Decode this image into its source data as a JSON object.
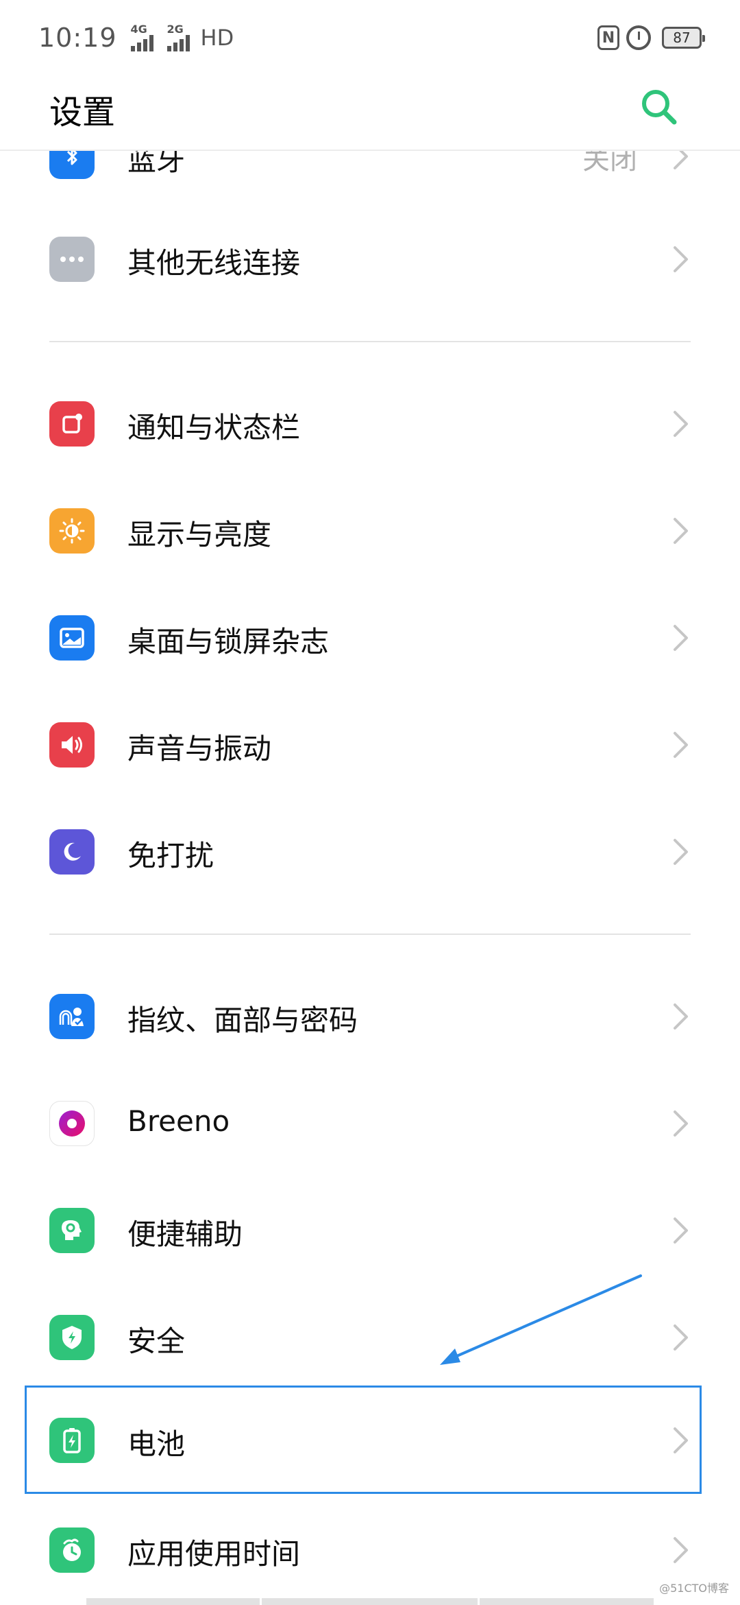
{
  "status_bar": {
    "time": "10:19",
    "signal1": "4G",
    "signal2": "2G",
    "hd": "HD",
    "nfc": "N",
    "battery": "87"
  },
  "header": {
    "title": "设置"
  },
  "rows": [
    {
      "label": "蓝牙",
      "value": "关闭",
      "icon": "bluetooth-icon",
      "color": "#1a7cf0"
    },
    {
      "label": "其他无线连接",
      "icon": "more-icon",
      "color": "#b7bcc4"
    },
    {
      "label": "通知与状态栏",
      "icon": "notification-icon",
      "color": "#e8404b"
    },
    {
      "label": "显示与亮度",
      "icon": "brightness-icon",
      "color": "#f7a531"
    },
    {
      "label": "桌面与锁屏杂志",
      "icon": "wallpaper-icon",
      "color": "#1a7cf0"
    },
    {
      "label": "声音与振动",
      "icon": "speaker-icon",
      "color": "#e8404b"
    },
    {
      "label": "免打扰",
      "icon": "moon-icon",
      "color": "#5d56d8"
    },
    {
      "label": "指纹、面部与密码",
      "icon": "fingerprint-icon",
      "color": "#1a7cf0"
    },
    {
      "label": "Breeno",
      "icon": "breeno-icon",
      "color": "#ffffff"
    },
    {
      "label": "便捷辅助",
      "icon": "assist-icon",
      "color": "#2fc47a"
    },
    {
      "label": "安全",
      "icon": "shield-icon",
      "color": "#2fc47a"
    },
    {
      "label": "电池",
      "icon": "battery-icon",
      "color": "#2fc47a"
    },
    {
      "label": "应用使用时间",
      "icon": "app-time-icon",
      "color": "#2fc47a"
    }
  ],
  "watermark": "@51CTO博客"
}
